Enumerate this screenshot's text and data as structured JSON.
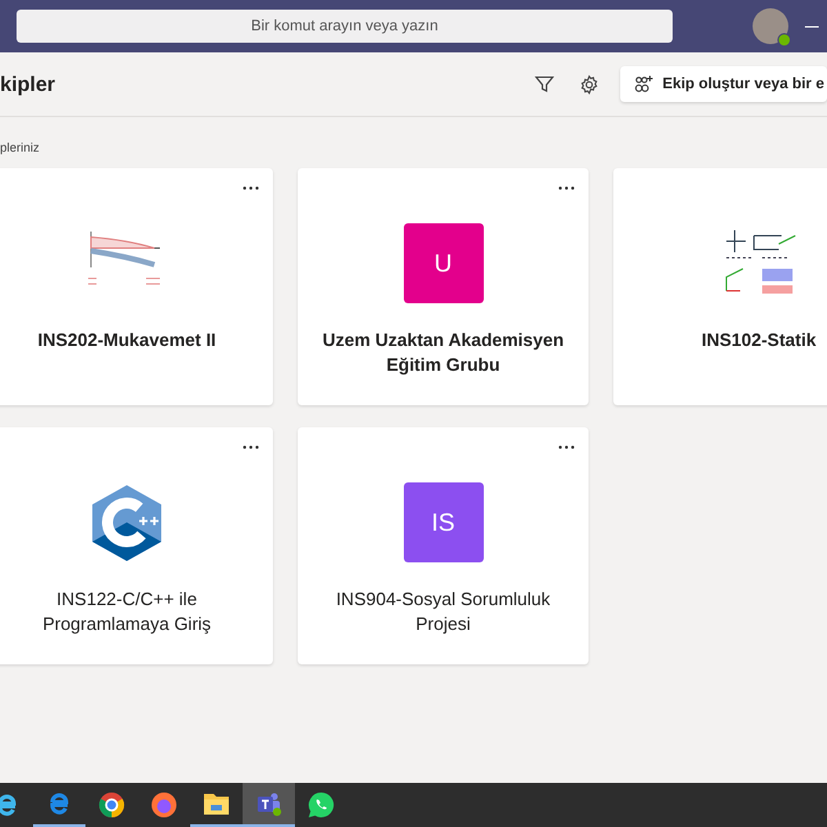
{
  "top_bar": {
    "search": {
      "placeholder": "Bir komut arayın veya yazın"
    }
  },
  "header": {
    "title": "kipler",
    "create_button": "Ekip oluştur veya bir e"
  },
  "section_label": "pleriniz",
  "teams": [
    {
      "name": "INS202-Mukavemet II",
      "kind": "picture",
      "unread": true
    },
    {
      "name": "Uzem Uzaktan Akademisyen Eğitim Grubu",
      "kind": "initials",
      "initials": "U",
      "color": "#e3008c",
      "unread": true
    },
    {
      "name": "INS102-Statik",
      "kind": "picture",
      "unread": true
    },
    {
      "name": "INS122-C/C++ ile Programlamaya Giriş",
      "kind": "picture",
      "unread": false
    },
    {
      "name": "INS904-Sosyal Sorumluluk Projesi",
      "kind": "initials",
      "initials": "IS",
      "color": "#8c4ff0",
      "unread": false
    }
  ],
  "taskbar": [
    {
      "selected": false,
      "running": false
    },
    {
      "selected": false,
      "running": true
    },
    {
      "selected": false,
      "running": false
    },
    {
      "selected": false,
      "running": false
    },
    {
      "selected": false,
      "running": true
    },
    {
      "selected": true,
      "running": true
    },
    {
      "selected": false,
      "running": false
    }
  ]
}
